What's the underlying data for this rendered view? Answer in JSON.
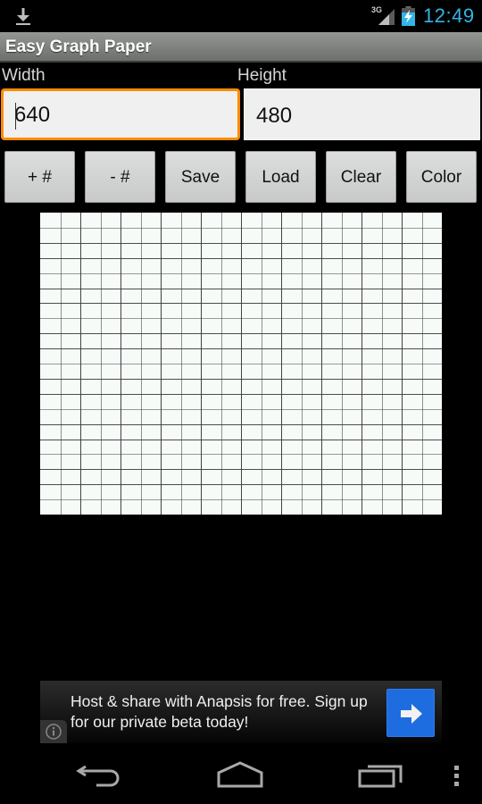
{
  "status_bar": {
    "network_type": "3G",
    "clock": "12:49",
    "icons": [
      "download-icon",
      "signal-icon",
      "battery-charging-icon"
    ],
    "clock_color": "#33b5e5"
  },
  "app": {
    "title": "Easy Graph Paper"
  },
  "form": {
    "width_label": "Width",
    "width_value": "640",
    "height_label": "Height",
    "height_value": "480",
    "focus_color": "#ff8a00"
  },
  "toolbar": {
    "buttons": [
      {
        "id": "add-grid",
        "label": "+ #"
      },
      {
        "id": "remove-grid",
        "label": "- #"
      },
      {
        "id": "save",
        "label": "Save"
      },
      {
        "id": "load",
        "label": "Load"
      },
      {
        "id": "clear",
        "label": "Clear"
      },
      {
        "id": "color",
        "label": "Color"
      }
    ]
  },
  "graph_paper": {
    "columns": 20,
    "rows": 20,
    "background_color": "#f6fbf8",
    "line_color": "#3a3a3a"
  },
  "ad": {
    "text": "Host & share with Anapsis for free. Sign up for our private beta today!",
    "button_color": "#1e6de0"
  },
  "nav_bar": {
    "icons": [
      "back-icon",
      "home-icon",
      "recent-apps-icon",
      "overflow-menu-icon"
    ]
  }
}
